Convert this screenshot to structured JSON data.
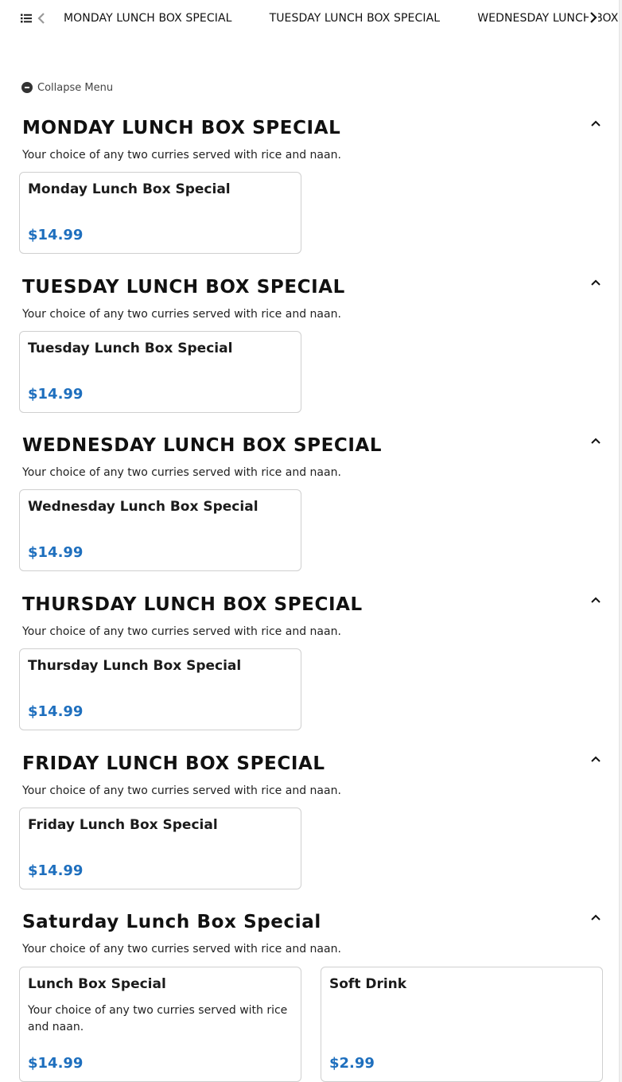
{
  "nav": {
    "tabs": [
      "MONDAY LUNCH BOX SPECIAL",
      "TUESDAY LUNCH BOX SPECIAL",
      "WEDNESDAY LUNCH BOX SPECIAL"
    ],
    "icons": {
      "menu": "list-icon",
      "prev": "chevron-left-icon",
      "next": "chevron-right-icon"
    }
  },
  "collapse": {
    "label": "Collapse Menu",
    "icon": "minus-circle-icon"
  },
  "sections": [
    {
      "title": "MONDAY LUNCH BOX SPECIAL",
      "desc": "Your choice of any two curries served with rice and naan.",
      "items": [
        {
          "name": "Monday Lunch Box Special",
          "desc": "",
          "price": "$14.99"
        }
      ]
    },
    {
      "title": "TUESDAY LUNCH BOX SPECIAL",
      "desc": "Your choice of any two curries served with rice and naan.",
      "items": [
        {
          "name": "Tuesday Lunch Box Special",
          "desc": "",
          "price": "$14.99"
        }
      ]
    },
    {
      "title": "WEDNESDAY LUNCH BOX SPECIAL",
      "desc": "Your choice of any two curries served with rice and naan.",
      "items": [
        {
          "name": "Wednesday Lunch Box Special",
          "desc": "",
          "price": "$14.99"
        }
      ]
    },
    {
      "title": "THURSDAY LUNCH BOX SPECIAL",
      "desc": "Your choice of any two curries served with rice and naan.",
      "items": [
        {
          "name": "Thursday Lunch Box Special",
          "desc": "",
          "price": "$14.99"
        }
      ]
    },
    {
      "title": "FRIDAY LUNCH BOX SPECIAL",
      "desc": "Your choice of any two curries served with rice and naan.",
      "items": [
        {
          "name": "Friday Lunch Box Special",
          "desc": "",
          "price": "$14.99"
        }
      ]
    },
    {
      "title": "Saturday Lunch Box Special",
      "desc": "Your choice of any two curries served with rice and naan.",
      "items": [
        {
          "name": "Lunch Box Special",
          "desc": "Your choice of any two curries served with rice and naan.",
          "price": "$14.99"
        },
        {
          "name": "Soft Drink",
          "desc": "",
          "price": "$2.99"
        }
      ]
    }
  ],
  "colors": {
    "price": "#1e6fbe",
    "text": "#111111",
    "border": "#cfcfcf"
  }
}
